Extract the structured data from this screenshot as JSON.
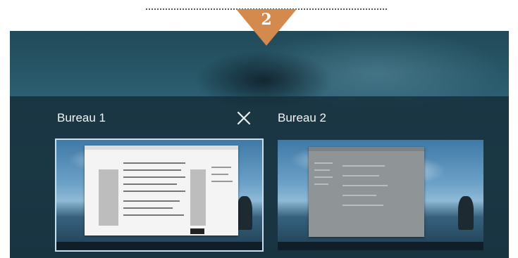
{
  "step": {
    "number": "2"
  },
  "virtual_desktops": [
    {
      "label": "Bureau 1",
      "selected": true
    },
    {
      "label": "Bureau 2",
      "selected": false
    }
  ],
  "close_icon": "close-icon",
  "colors": {
    "badge": "#d48a4c",
    "selection_border": "#c9dff0",
    "panel": "#162c38"
  }
}
